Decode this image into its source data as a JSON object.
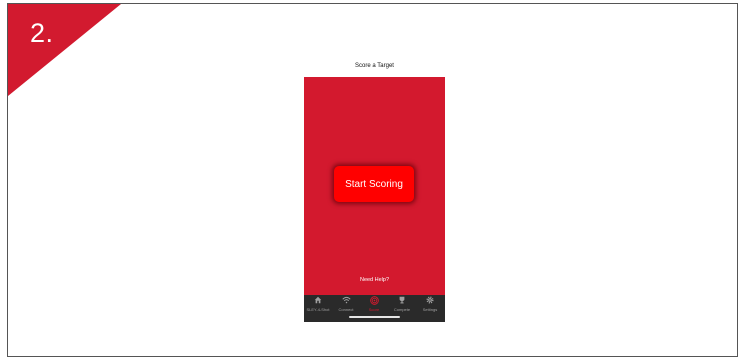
{
  "step": {
    "number": "2.",
    "color": "#d21a2f"
  },
  "app": {
    "title": "Score a Target",
    "start_button_label": "Start Scoring",
    "help_link": "Need Help?",
    "accent_color": "#d3192e",
    "button_color": "#ff0000"
  },
  "tabbar": {
    "active": "Score",
    "items": [
      {
        "label": "SLEY-4-Shot",
        "icon": "home-icon"
      },
      {
        "label": "Connect",
        "icon": "wifi-icon"
      },
      {
        "label": "Score",
        "icon": "target-icon"
      },
      {
        "label": "Compete",
        "icon": "trophy-icon"
      },
      {
        "label": "Settings",
        "icon": "gear-icon"
      }
    ]
  }
}
